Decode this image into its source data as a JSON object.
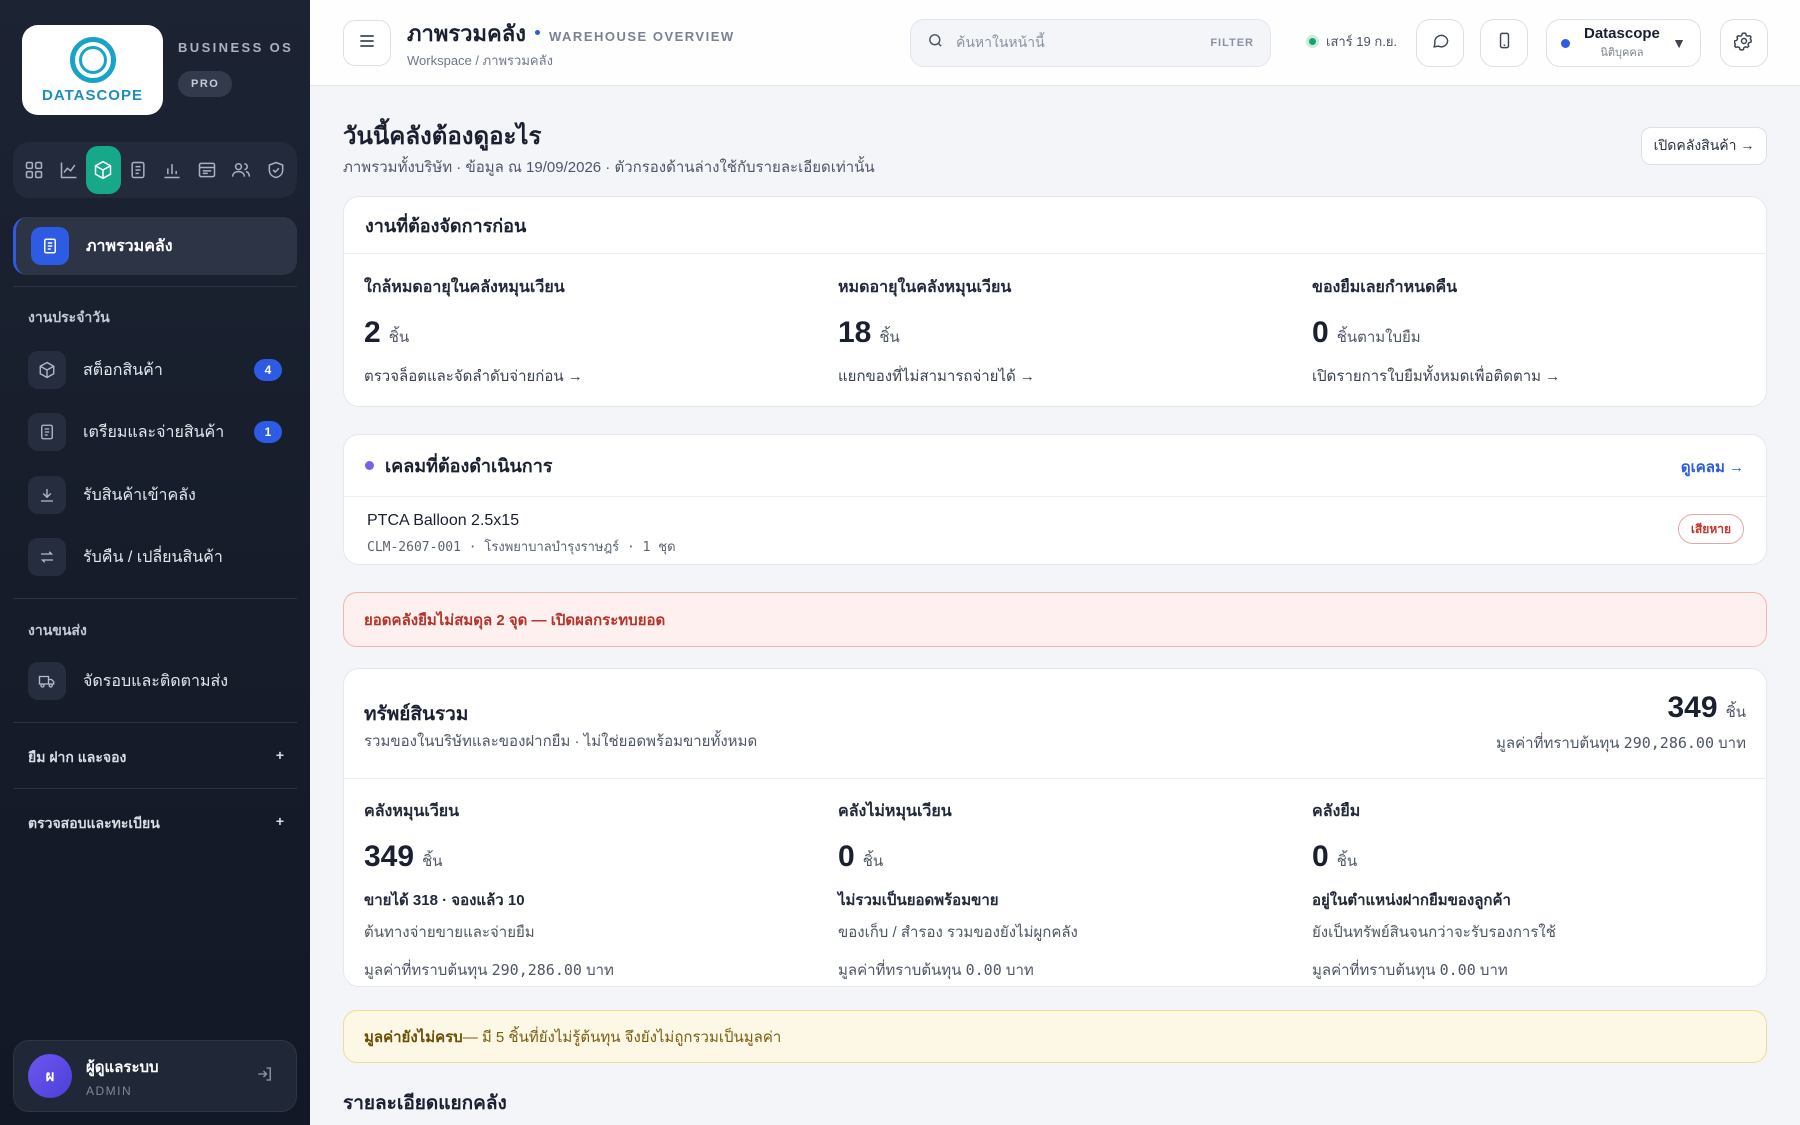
{
  "brand": {
    "logo_text": "DATASCOPE",
    "subtitle": "BUSINESS OS",
    "plan": "PRO"
  },
  "icon_bar": [
    "grid-icon",
    "chart-line-icon",
    "box-icon",
    "document-icon",
    "bar-chart-icon",
    "table-icon",
    "users-icon",
    "shield-icon"
  ],
  "sidebar": {
    "active": {
      "label": "ภาพรวมคลัง",
      "icon": "document-icon"
    },
    "daily_section": "งานประจำวัน",
    "daily_items": [
      {
        "label": "สต็อกสินค้า",
        "badge": "4",
        "icon": "box-icon"
      },
      {
        "label": "เตรียมและจ่ายสินค้า",
        "badge": "1",
        "icon": "document-icon"
      },
      {
        "label": "รับสินค้าเข้าคลัง",
        "icon": "download-icon"
      },
      {
        "label": "รับคืน / เปลี่ยนสินค้า",
        "icon": "swap-icon"
      }
    ],
    "shipping_section": "งานขนส่ง",
    "shipping_items": [
      {
        "label": "จัดรอบและติดตามส่ง",
        "icon": "truck-icon"
      }
    ],
    "collapsibles": [
      {
        "label": "ยืม ฝาก และจอง",
        "toggle": "+"
      },
      {
        "label": "ตรวจสอบและทะเบียน",
        "toggle": "+"
      }
    ],
    "user": {
      "initial": "ผ",
      "name": "ผู้ดูแลระบบ",
      "role": "ADMIN"
    }
  },
  "topbar": {
    "title": "ภาพรวมคลัง",
    "subtitle": "WAREHOUSE OVERVIEW",
    "breadcrumb": "Workspace / ภาพรวมคลัง",
    "search_placeholder": "ค้นหาในหน้านี้",
    "filter_label": "FILTER",
    "date": "เสาร์ 19 ก.ย.",
    "org_name": "Datascope",
    "org_type": "นิติบุคคล"
  },
  "header": {
    "title": "วันนี้คลังต้องดูอะไร",
    "subtitle": "ภาพรวมทั้งบริษัท · ข้อมูล ณ 19/09/2026 · ตัวกรองด้านล่างใช้กับรายละเอียดเท่านั้น",
    "open_button": "เปิดคลังสินค้า →"
  },
  "priority": {
    "title": "งานที่ต้องจัดการก่อน",
    "cols": [
      {
        "label": "ใกล้หมดอายุในคลังหมุนเวียน",
        "value": "2",
        "unit": "ชิ้น",
        "link": "ตรวจล็อตและจัดลำดับจ่ายก่อน →"
      },
      {
        "label": "หมดอายุในคลังหมุนเวียน",
        "value": "18",
        "unit": "ชิ้น",
        "link": "แยกของที่ไม่สามารถจ่ายได้ →"
      },
      {
        "label": "ของยืมเลยกำหนดคืน",
        "value": "0",
        "unit": "ชิ้นตามใบยืม",
        "link": "เปิดรายการใบยืมทั้งหมดเพื่อติดตาม →"
      }
    ]
  },
  "claims": {
    "title": "เคลมที่ต้องดำเนินการ",
    "see_all": "ดูเคลม →",
    "item": {
      "name": "PTCA Balloon 2.5x15",
      "meta": "CLM-2607-001 · โรงพยาบาลบำรุงราษฎร์ · 1 ชุด",
      "status": "เสียหาย"
    }
  },
  "alert_red": "ยอดคลังยืมไม่สมดุล 2 จุด — เปิดผลกระทบยอด",
  "assets": {
    "title": "ทรัพย์สินรวม",
    "subtitle": "รวมของในบริษัทและของฝากยืม · ไม่ใช่ยอดพร้อมขายทั้งหมด",
    "total": "349",
    "total_unit": "ชิ้น",
    "total_value_label": "มูลค่าที่ทราบต้นทุน",
    "total_value": "290,286.00",
    "currency": "บาท",
    "cols": [
      {
        "label": "คลังหมุนเวียน",
        "value": "349",
        "unit": "ชิ้น",
        "line1": "ขายได้ 318 · จองแล้ว 10",
        "line2": "ต้นทางจ่ายขายและจ่ายยืม",
        "value_label": "มูลค่าที่ทราบต้นทุน",
        "amount": "290,286.00",
        "currency": "บาท"
      },
      {
        "label": "คลังไม่หมุนเวียน",
        "value": "0",
        "unit": "ชิ้น",
        "line1": "ไม่รวมเป็นยอดพร้อมขาย",
        "line2": "ของเก็บ / สำรอง รวมของยังไม่ผูกคลัง",
        "value_label": "มูลค่าที่ทราบต้นทุน",
        "amount": "0.00",
        "currency": "บาท"
      },
      {
        "label": "คลังยืม",
        "value": "0",
        "unit": "ชิ้น",
        "line1": "อยู่ในตำแหน่งฝากยืมของลูกค้า",
        "line2": "ยังเป็นทรัพย์สินจนกว่าจะรับรองการใช้",
        "value_label": "มูลค่าที่ทราบต้นทุน",
        "amount": "0.00",
        "currency": "บาท"
      }
    ]
  },
  "alert_amber": {
    "strong": "มูลค่ายังไม่ครบ",
    "rest": " — มี 5 ชิ้นที่ยังไม่รู้ต้นทุน จึงยังไม่ถูกรวมเป็นมูลค่า"
  },
  "details_title": "รายละเอียดแยกคลัง"
}
